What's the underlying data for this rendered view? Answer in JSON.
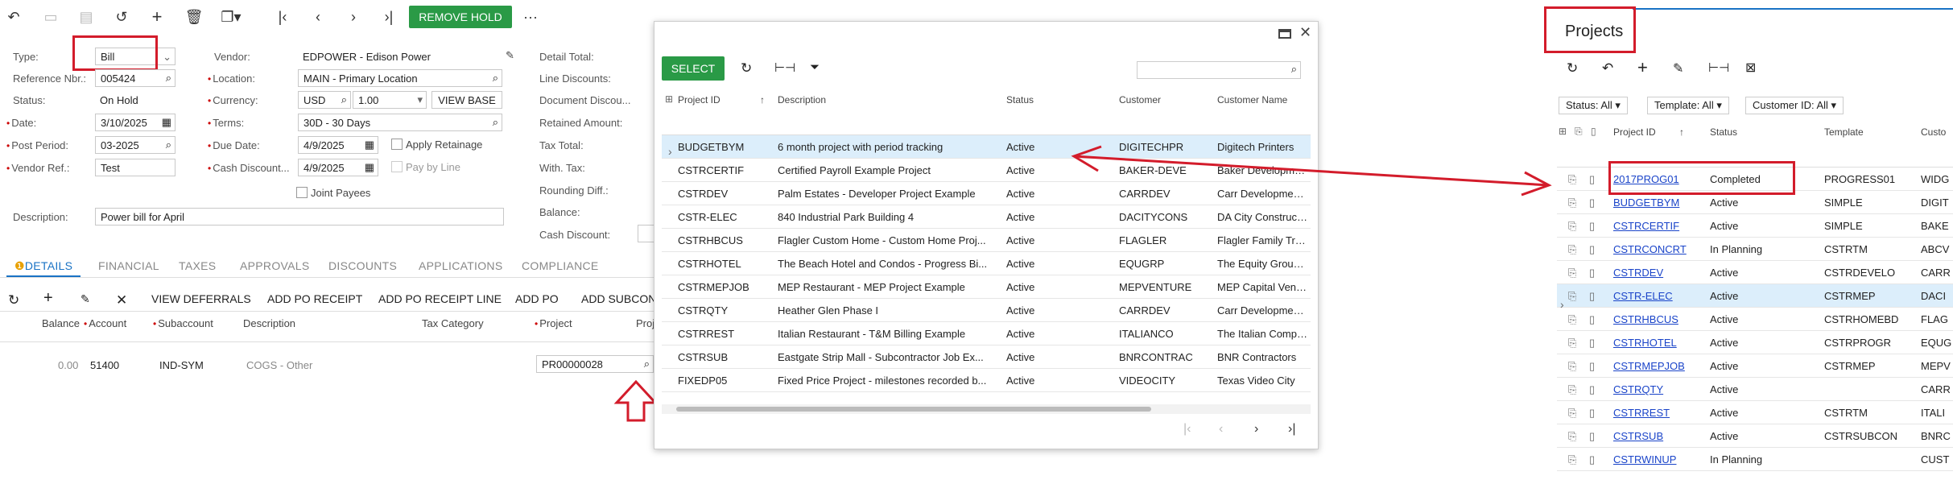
{
  "toolbar": {
    "icons": [
      "undo-icon",
      "save-icon",
      "save-close-icon",
      "redo-icon",
      "add-icon",
      "delete-icon",
      "copy-icon",
      "first-icon",
      "prev-icon",
      "next-icon",
      "last-icon"
    ],
    "remove_hold": "REMOVE HOLD",
    "more": "···"
  },
  "form": {
    "type_label": "Type:",
    "type_value": "Bill",
    "ref_label": "Reference Nbr.:",
    "ref_value": "005424",
    "status_label": "Status:",
    "status_value": "On Hold",
    "date_label": "Date:",
    "date_value": "3/10/2025",
    "post_label": "Post Period:",
    "post_value": "03-2025",
    "vref_label": "Vendor Ref.:",
    "vref_value": "Test",
    "desc_label": "Description:",
    "desc_value": "Power bill for April",
    "vendor_label": "Vendor:",
    "vendor_value": "EDPOWER - Edison Power",
    "location_label": "Location:",
    "location_value": "MAIN - Primary Location",
    "currency_label": "Currency:",
    "currency_value": "USD",
    "rate_value": "1.00",
    "view_base": "VIEW BASE",
    "terms_label": "Terms:",
    "terms_value": "30D - 30 Days",
    "due_label": "Due Date:",
    "due_value": "4/9/2025",
    "cashd_label": "Cash Discount...",
    "cashd_value": "4/9/2025",
    "apply_retainage": "Apply Retainage",
    "pay_by_line": "Pay by Line",
    "joint_payees": "Joint Payees",
    "totals": [
      "Detail Total:",
      "Line Discounts:",
      "Document Discou...",
      "Retained Amount:",
      "Tax Total:",
      "With. Tax:",
      "Rounding Diff.:",
      "Balance:",
      "Cash Discount:"
    ]
  },
  "tabs": [
    "DETAILS",
    "FINANCIAL",
    "TAXES",
    "APPROVALS",
    "DISCOUNTS",
    "APPLICATIONS",
    "COMPLIANCE"
  ],
  "grid_toolbar": [
    "VIEW DEFERRALS",
    "ADD PO RECEIPT",
    "ADD PO RECEIPT LINE",
    "ADD PO",
    "ADD SUBCON"
  ],
  "grid": {
    "headers": [
      "Balance",
      "Account",
      "Subaccount",
      "Description",
      "Tax Category",
      "Project",
      "Proj"
    ],
    "row": {
      "balance": "0.00",
      "account": "51400",
      "subaccount": "IND-SYM",
      "description": "COGS - Other",
      "project": "PR00000028"
    }
  },
  "lookup": {
    "select": "SELECT",
    "headers": [
      "Project ID",
      "Description",
      "Status",
      "Customer",
      "Customer Name"
    ],
    "rows": [
      [
        "BUDGETBYM",
        "6 month project with period tracking",
        "Active",
        "DIGITECHPR",
        "Digitech Printers"
      ],
      [
        "CSTRCERTIF",
        "Certified Payroll Example Project",
        "Active",
        "BAKER-DEVE",
        "Baker Development"
      ],
      [
        "CSTRDEV",
        "Palm Estates - Developer Project Example",
        "Active",
        "CARRDEV",
        "Carr Development I"
      ],
      [
        "CSTR-ELEC",
        "840 Industrial Park Building 4",
        "Active",
        "DACITYCONS",
        "DA City Constructio"
      ],
      [
        "CSTRHBCUS",
        "Flagler Custom Home - Custom Home Proj...",
        "Active",
        "FLAGLER",
        "Flagler Family Trust"
      ],
      [
        "CSTRHOTEL",
        "The Beach Hotel and Condos - Progress Bi...",
        "Active",
        "EQUGRP",
        "The Equity Group In"
      ],
      [
        "CSTRMEPJOB",
        "MEP Restaurant - MEP Project Example",
        "Active",
        "MEPVENTURE",
        "MEP Capital Ventur"
      ],
      [
        "CSTRQTY",
        "Heather Glen Phase I",
        "Active",
        "CARRDEV",
        "Carr Development I"
      ],
      [
        "CSTRREST",
        "Italian Restaurant - T&M Billing Example",
        "Active",
        "ITALIANCO",
        "The Italian Compan"
      ],
      [
        "CSTRSUB",
        "Eastgate Strip Mall - Subcontractor Job Ex...",
        "Active",
        "BNRCONTRAC",
        "BNR Contractors"
      ],
      [
        "FIXEDP05",
        "Fixed Price Project - milestones recorded b...",
        "Active",
        "VIDEOCITY",
        "Texas Video City"
      ]
    ]
  },
  "projects": {
    "title": "Projects",
    "filters": [
      "Status: All",
      "Template: All",
      "Customer ID: All"
    ],
    "headers": [
      "Project ID",
      "Status",
      "Template",
      "Custo"
    ],
    "rows": [
      [
        "2017PROG01",
        "Completed",
        "PROGRESS01",
        "WIDG"
      ],
      [
        "BUDGETBYM",
        "Active",
        "SIMPLE",
        "DIGIT"
      ],
      [
        "CSTRCERTIF",
        "Active",
        "SIMPLE",
        "BAKE"
      ],
      [
        "CSTRCONCRT",
        "In Planning",
        "CSTRTM",
        "ABCV"
      ],
      [
        "CSTRDEV",
        "Active",
        "CSTRDEVELO",
        "CARR"
      ],
      [
        "CSTR-ELEC",
        "Active",
        "CSTRMEP",
        "DACI"
      ],
      [
        "CSTRHBCUS",
        "Active",
        "CSTRHOMEBD",
        "FLAG"
      ],
      [
        "CSTRHOTEL",
        "Active",
        "CSTRPROGR",
        "EQUG"
      ],
      [
        "CSTRMEPJOB",
        "Active",
        "CSTRMEP",
        "MEPV"
      ],
      [
        "CSTRQTY",
        "Active",
        "",
        "CARR"
      ],
      [
        "CSTRREST",
        "Active",
        "CSTRTM",
        "ITALI"
      ],
      [
        "CSTRSUB",
        "Active",
        "CSTRSUBCON",
        "BNRC"
      ],
      [
        "CSTRWINUP",
        "In Planning",
        "",
        "CUST"
      ]
    ]
  }
}
